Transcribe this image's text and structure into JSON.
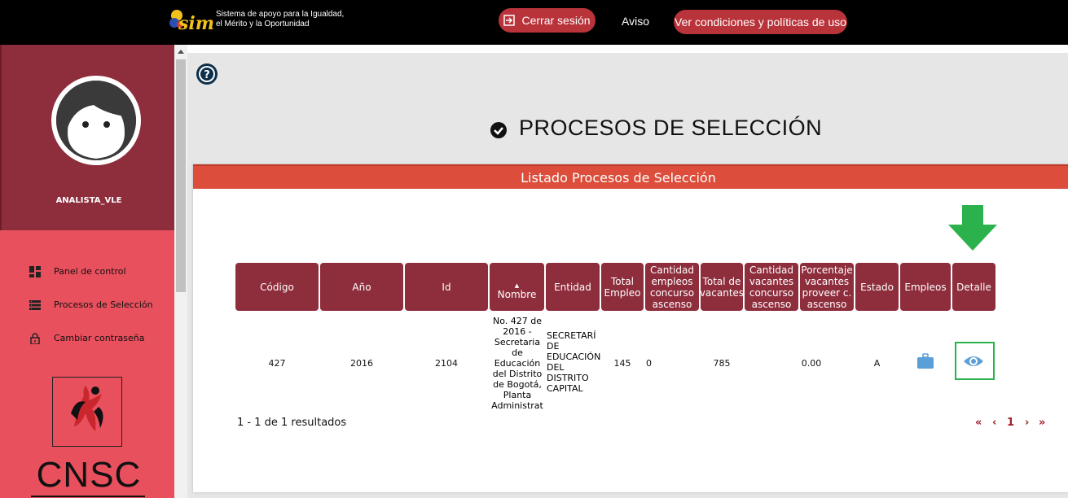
{
  "header": {
    "logo_word": "simo",
    "logo_line1": "Sistema de apoyo para la Igualdad,",
    "logo_line2": "el Mérito y la Oportunidad",
    "logout_label": "Cerrar sesión",
    "aviso_label": "Aviso",
    "terms_label": "Ver condiciones y políticas de uso"
  },
  "sidebar": {
    "username": "ANALISTA_VLE",
    "items": [
      {
        "label": "Panel de control",
        "icon": "dashboard-icon"
      },
      {
        "label": "Procesos de Selección",
        "icon": "list-icon"
      },
      {
        "label": "Cambiar contraseña",
        "icon": "lock-icon"
      }
    ],
    "org_logo_text": "CNSC"
  },
  "page": {
    "title": "PROCESOS DE SELECCIÓN",
    "panel_title": "Listado Procesos de Selección"
  },
  "table": {
    "columns": [
      {
        "label": "Código"
      },
      {
        "label": "Año"
      },
      {
        "label": "Id"
      },
      {
        "label": "Nombre",
        "sorted": "asc"
      },
      {
        "label": "Entidad"
      },
      {
        "label": "Total Empleo"
      },
      {
        "label": "Cantidad empleos concurso ascenso"
      },
      {
        "label": "Total de vacantes"
      },
      {
        "label": "Cantidad vacantes concurso ascenso"
      },
      {
        "label": "Porcentaje vacantes proveer c. ascenso"
      },
      {
        "label": "Estado"
      },
      {
        "label": "Empleos"
      },
      {
        "label": "Detalle"
      }
    ],
    "rows": [
      {
        "codigo": "427",
        "anio": "2016",
        "id": "2104",
        "nombre": [
          "No. 427 de",
          "2016 -",
          "Secretaria",
          "de",
          "Educación",
          "del Distrito",
          "de Bogotá,",
          "Planta",
          "Administrat"
        ],
        "entidad": [
          "SECRETARÍ",
          "DE",
          "EDUCACIÓN",
          "DEL",
          "DISTRITO",
          "CAPITAL"
        ],
        "total_empleo": "145",
        "cantidad_empleos_ascenso": "0",
        "total_vacantes": "785",
        "cantidad_vacantes_ascenso": "",
        "porcentaje": "0.00",
        "estado": "A"
      }
    ]
  },
  "pagination": {
    "summary": "1 - 1 de 1 resultados",
    "first": "«",
    "prev": "‹",
    "current": "1",
    "next": "›",
    "last": "»"
  },
  "colors": {
    "sidebar_dark": "#8e2d3c",
    "sidebar_light": "#e8505d",
    "panel_header": "#dc4e3b",
    "pill": "#b8333a",
    "highlight_green": "#2bb24c"
  }
}
